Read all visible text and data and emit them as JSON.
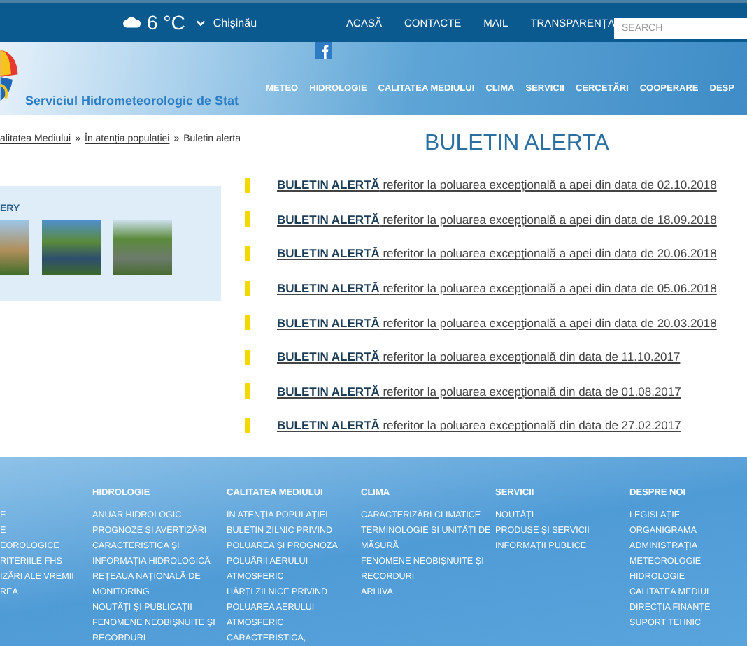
{
  "top_bar": {
    "weather": {
      "temperature": "6 °C",
      "city": "Chișinău"
    },
    "links": [
      "ACASĂ",
      "CONTACTE",
      "MAIL",
      "TRANSPARENȚA"
    ],
    "search": {
      "placeholder": "SEARCH"
    }
  },
  "header": {
    "site_title": "Serviciul Hidrometeorologic de Stat",
    "nav": [
      "METEO",
      "HIDROLOGIE",
      "CALITATEA MEDIULUI",
      "CLIMA",
      "SERVICII",
      "CERCETĂRI",
      "COOPERARE",
      "DESP"
    ]
  },
  "breadcrumb": [
    {
      "kind": "link",
      "text": "alitatea Mediului"
    },
    {
      "kind": "sep",
      "text": "»"
    },
    {
      "kind": "link",
      "text": "În atenția populației"
    },
    {
      "kind": "sep",
      "text": "»"
    },
    {
      "kind": "current",
      "text": "Buletin alerta"
    }
  ],
  "sidebar": {
    "heading": "ERY"
  },
  "page_title": "BULETIN ALERTA",
  "alerts": [
    {
      "text": "**BULETIN ALERTĂ** referitor la poluarea excepţională a apei din data de 02.10.2018"
    },
    {
      "text": "**BULETIN ALERTĂ** referitor la poluarea excepţională a apei din data de 18.09.2018"
    },
    {
      "text": "**BULETIN ALERTĂ** referitor la poluarea excepţională a apei din data de 20.06.2018"
    },
    {
      "text": "**BULETIN ALERTĂ** referitor la poluarea excepţională a apei din data de 05.06.2018"
    },
    {
      "text": "**BULETIN ALERTĂ** referitor la poluarea excepţională a apei din data de 20.03.2018"
    },
    {
      "text": "**BULETIN  ALERTĂ** referitor la poluarea excepţională din data de 11.10.2017"
    },
    {
      "text": "**BULETIN ALERTĂ** referitor la poluarea excepţională din data de 01.08.2017"
    },
    {
      "text": "**BULETIN ALERTĂ** referitor la poluarea excepţională din data de 27.02.2017"
    }
  ],
  "footer": [
    {
      "items": [
        "E",
        "E",
        "EOROLOGICE",
        "RITERIILE FHS",
        "IZĂRI ALE VREMII",
        "REA"
      ]
    },
    {
      "heading": "HIDROLOGIE",
      "items": [
        "ANUAR HIDROLOGIC",
        "PROGNOZE ȘI AVERTIZĂRI",
        "CARACTERISTICA ȘI INFORMAȚIA HIDROLOGICĂ",
        "REȚEAUA NAȚIONALĂ DE MONITORING",
        "NOUTĂȚI ȘI PUBLICAȚII",
        "FENOMENE NEOBIȘNUITE ȘI RECORDURI"
      ]
    },
    {
      "heading": "CALITATEA MEDIULUI",
      "items": [
        "ÎN ATENȚIA POPULAȚIEI",
        "BULETIN ZILNIC PRIVIND POLUAREA ȘI PROGNOZA POLUĂRII AERULUI ATMOSFERIC",
        "HĂRȚI ZILNICE PRIVIND POLUAREA AERULUI ATMOSFERIC",
        "CARACTERISTICA,"
      ]
    },
    {
      "heading": "CLIMA",
      "items": [
        "CARACTERIZĂRI CLIMATICE",
        "TERMINOLOGIE ȘI UNITĂȚI DE MĂSURĂ",
        "FENOMENE NEOBIȘNUITE ȘI RECORDURI",
        "ARHIVA"
      ]
    },
    {
      "heading": "SERVICII",
      "items": [
        "NOUTĂȚI",
        "PRODUSE ȘI SERVICII",
        "INFORMAȚII PUBLICE"
      ]
    },
    {
      "heading": "DESPRE NOI",
      "items": [
        "LEGISLAȚIE",
        "ORGANIGRAMA",
        "ADMINISTRAȚIA",
        "METEOROLOGIE",
        "HIDROLOGIE",
        "CALITATEA MEDIUL",
        "DIRECȚIA FINANȚE",
        "SUPORT TEHNIC"
      ]
    }
  ]
}
